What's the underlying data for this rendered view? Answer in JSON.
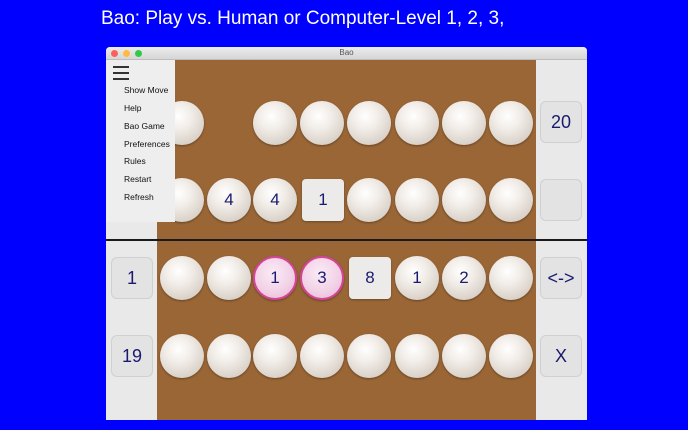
{
  "banner": "Bao: Play vs. Human or Computer-Level 1, 2, 3,",
  "window": {
    "title": "Bao"
  },
  "menu": {
    "items": [
      "Show Move",
      "Help",
      "Bao Game",
      "Preferences",
      "Rules",
      "Restart",
      "Refresh"
    ]
  },
  "board": {
    "rows": [
      [
        "",
        "",
        "",
        "",
        "",
        "",
        "",
        ""
      ],
      [
        "",
        "4",
        "4",
        "1",
        "",
        "",
        "",
        ""
      ],
      [
        "",
        "",
        "1",
        "3",
        "8",
        "1",
        "2",
        ""
      ],
      [
        "",
        "",
        "",
        "",
        "",
        "",
        "",
        ""
      ]
    ]
  },
  "side_right": {
    "top": "20",
    "upper": "",
    "swap": "<->",
    "close": "X"
  },
  "side_left": {
    "lower_top": "1",
    "bottom": "19"
  },
  "colors": {
    "background": "#0000ff",
    "board": "#9a6636",
    "highlight": "#d6449a",
    "text": "#1a1a6e"
  }
}
